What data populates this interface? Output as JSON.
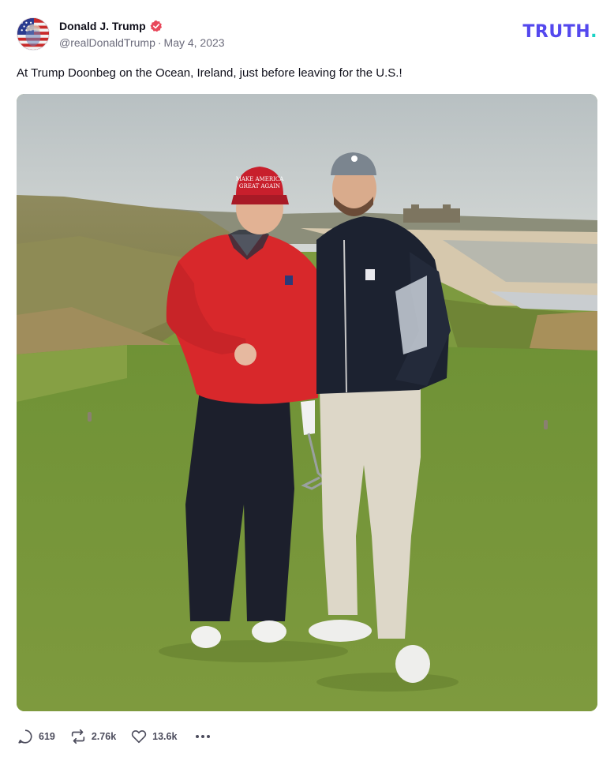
{
  "post": {
    "author": {
      "display_name": "Donald J. Trump",
      "handle": "@realDonaldTrump",
      "verified": true,
      "avatar_icon": "avatar-flag-portrait"
    },
    "separator": "·",
    "date": "May 4, 2023",
    "brand": {
      "logo_text": "TRUTH",
      "logo_dot": ".",
      "color_primary": "#5448ee",
      "color_dot": "#19d3c5"
    },
    "body_text": "At Trump Doonbeg on the Ocean, Ireland, just before leaving for the U.S.!",
    "hat_text_line1": "MAKE AMERICA",
    "hat_text_line2": "GREAT AGAIN",
    "actions": {
      "replies": {
        "icon": "reply-icon",
        "count": "619"
      },
      "retruths": {
        "icon": "retruth-icon",
        "count": "2.76k"
      },
      "likes": {
        "icon": "heart-icon",
        "count": "13.6k"
      },
      "more": {
        "icon": "more-icon"
      }
    },
    "colors": {
      "verified_badge": "#e8475a",
      "text_muted": "#6b6b7b"
    }
  }
}
